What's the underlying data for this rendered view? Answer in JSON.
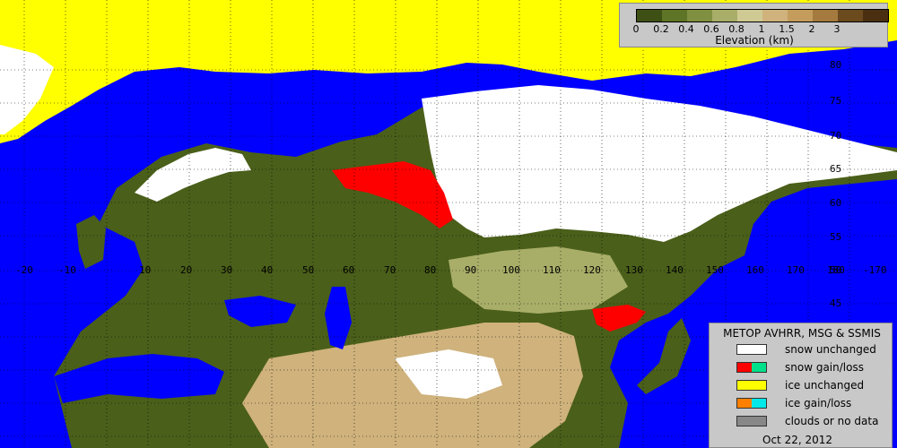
{
  "map": {
    "lat_labels": [
      "80",
      "75",
      "70",
      "65",
      "60",
      "55",
      "50",
      "45",
      "40"
    ],
    "lon_labels": [
      "-20",
      "-10",
      "10",
      "20",
      "30",
      "40",
      "50",
      "60",
      "70",
      "80",
      "90",
      "100",
      "110",
      "120",
      "130",
      "140",
      "150",
      "160",
      "170",
      "180",
      "-170"
    ],
    "colors": {
      "water": "#0000ff",
      "ice": "#ffff00",
      "snow": "#ffffff",
      "snow_gain": "#ff0000",
      "snow_loss": "#00e08a",
      "ice_gain": "#ff8000",
      "ice_loss": "#00e8e8",
      "clouds": "#888888",
      "lowland": "#4a5f1a"
    }
  },
  "elevation_legend": {
    "title": "Elevation (km)",
    "ticks": [
      "0",
      "0.2",
      "0.4",
      "0.6",
      "0.8",
      "1",
      "1.5",
      "2",
      "3"
    ],
    "colors": [
      "#3f5015",
      "#5e7426",
      "#7f9040",
      "#a8ae68",
      "#cfca94",
      "#cfb27c",
      "#c49c5c",
      "#a57a3e",
      "#6b4a1e",
      "#4a3010"
    ]
  },
  "status_legend": {
    "title": "METOP AVHRR, MSG & SSMIS",
    "items": [
      {
        "label": "snow unchanged",
        "colors": [
          "#ffffff"
        ]
      },
      {
        "label": "snow gain/loss",
        "colors": [
          "#ff0000",
          "#00e08a"
        ]
      },
      {
        "label": "ice unchanged",
        "colors": [
          "#ffff00"
        ]
      },
      {
        "label": "ice gain/loss",
        "colors": [
          "#ff8000",
          "#00e8e8"
        ]
      },
      {
        "label": "clouds or no data",
        "colors": [
          "#888888"
        ]
      }
    ],
    "date": "Oct 22, 2012"
  }
}
